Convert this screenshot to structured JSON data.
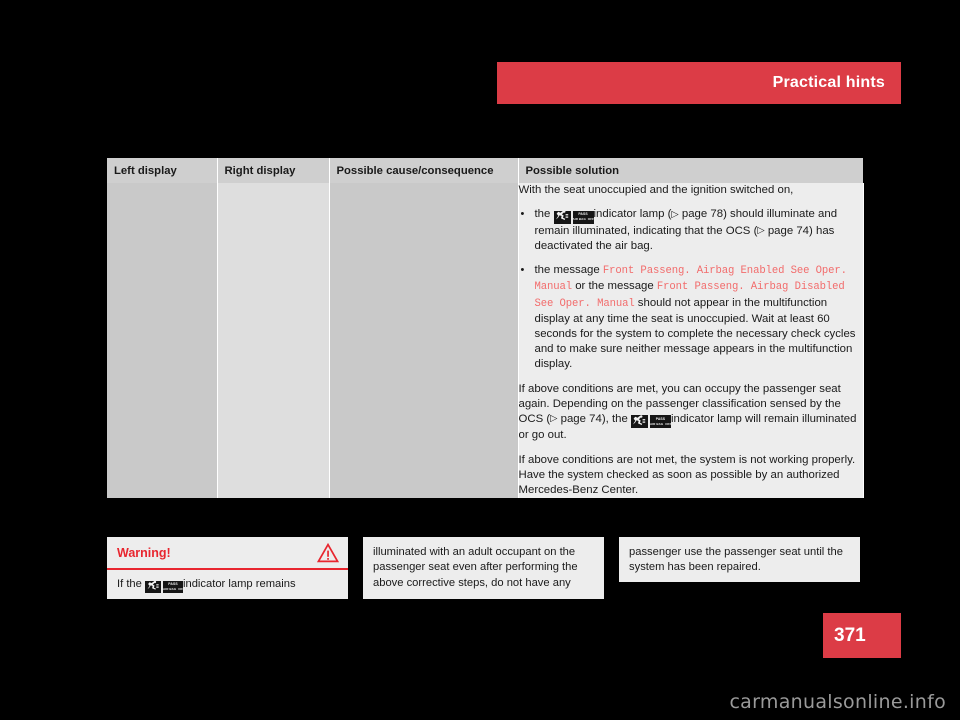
{
  "header": {
    "title": "Practical hints"
  },
  "table": {
    "columns": [
      "Left display",
      "Right display",
      "Possible cause/consequence",
      "Possible solution"
    ],
    "solution": {
      "intro": "With the seat unoccupied and the ignition switched on,",
      "bullets": [
        {
          "pre": "the",
          "icon": "passenger-airbag-off-indicator-icon",
          "post_a": "indicator lamp (",
          "ref_a": "page 78",
          "post_b": ") should illuminate and remain illuminated, indicating that the OCS (",
          "ref_b": "page 74",
          "post_c": ") has deactivated the air bag."
        },
        {
          "pre": "the message",
          "msg_1": "Front Passeng. Airbag Enabled See Oper. Manual",
          "mid": "or the message",
          "msg_2": "Front Passeng. Airbag Disabled See Oper. Manual",
          "post": "should not appear in the multifunction display at any time the seat is unoccupied. Wait at least 60 seconds for the system to complete the necessary check cycles and to make sure neither message appears in the multifunction display."
        }
      ],
      "para_2_a": "If above conditions are met, you can occupy the passenger seat again. Depending on the passenger classification sensed by the OCS (",
      "para_2_ref": "page 74",
      "para_2_b": "), the",
      "para_2_c": "indicator lamp will remain illuminated or go out.",
      "para_3": "If above conditions are not met, the system is not working properly. Have the system checked as soon as possible by an authorized Mercedes-Benz Center."
    }
  },
  "warning_box": {
    "title": "Warning!",
    "icon": "warning-triangle-icon",
    "text_pre": "If the",
    "lamp_icon": "passenger-airbag-off-indicator-icon",
    "text_post": "indicator lamp remains"
  },
  "continuation_middle": {
    "text": "illuminated with an adult occupant on the passenger seat even after performing the above corrective steps, do not have any"
  },
  "continuation_right": {
    "text": "passenger use the passenger seat until the system has been repaired."
  },
  "page_badge": {
    "number": "371"
  },
  "watermark": {
    "text": "carmanualsonline.info"
  },
  "icon_labels": {
    "pass_line1": "PASS",
    "pass_line2": "AIR BAG",
    "pass_off": "OFF"
  },
  "colors": {
    "accent_red": "#DC3C46",
    "warning_red": "#E8262F",
    "mono_red": "#F26C6C",
    "page_bg": "#000000"
  }
}
